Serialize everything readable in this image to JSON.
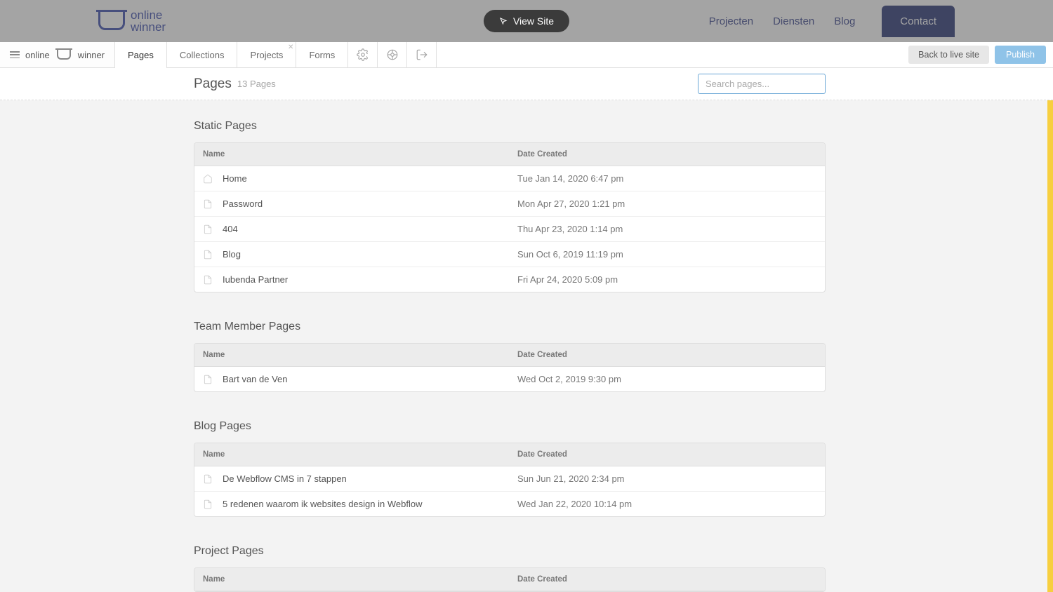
{
  "site": {
    "logo_text_1": "online",
    "logo_text_2": "winner",
    "nav": {
      "projecten": "Projecten",
      "diensten": "Diensten",
      "blog": "Blog",
      "contact": "Contact"
    },
    "view_site": "View Site"
  },
  "editor": {
    "project_label_1": "online",
    "project_label_2": "winner",
    "tabs": {
      "pages": "Pages",
      "collections": "Collections",
      "projects": "Projects",
      "forms": "Forms"
    },
    "back_to_live": "Back to live site",
    "publish": "Publish"
  },
  "header": {
    "title": "Pages",
    "count": "13 Pages",
    "search_placeholder": "Search pages..."
  },
  "columns": {
    "name": "Name",
    "date": "Date Created"
  },
  "sections": [
    {
      "title": "Static Pages",
      "rows": [
        {
          "icon": "home",
          "name": "Home",
          "date": "Tue Jan 14, 2020 6:47 pm"
        },
        {
          "icon": "page",
          "name": "Password",
          "date": "Mon Apr 27, 2020 1:21 pm"
        },
        {
          "icon": "page",
          "name": "404",
          "date": "Thu Apr 23, 2020 1:14 pm"
        },
        {
          "icon": "page",
          "name": "Blog",
          "date": "Sun Oct 6, 2019 11:19 pm"
        },
        {
          "icon": "page",
          "name": "Iubenda Partner",
          "date": "Fri Apr 24, 2020 5:09 pm"
        }
      ]
    },
    {
      "title": "Team Member Pages",
      "rows": [
        {
          "icon": "page",
          "name": "Bart van de Ven",
          "date": "Wed Oct 2, 2019 9:30 pm"
        }
      ]
    },
    {
      "title": "Blog Pages",
      "rows": [
        {
          "icon": "page",
          "name": "De Webflow CMS in 7 stappen",
          "date": "Sun Jun 21, 2020 2:34 pm"
        },
        {
          "icon": "page",
          "name": "5 redenen waarom ik websites design in Webflow",
          "date": "Wed Jan 22, 2020 10:14 pm"
        }
      ]
    },
    {
      "title": "Project Pages",
      "rows": []
    }
  ]
}
